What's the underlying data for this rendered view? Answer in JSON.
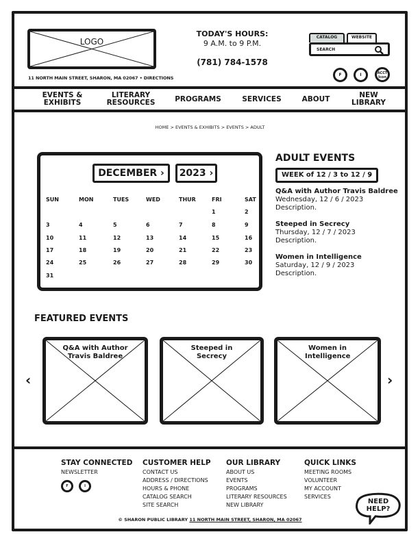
{
  "header": {
    "logo_label": "LOGO",
    "address": "11 NORTH MAIN STREET, SHARON, MA 02067 • DIRECTIONS",
    "hours_title": "TODAY'S HOURS:",
    "hours_value": "9 A.M. to 9 P.M.",
    "phone": "(781) 784-1578",
    "search_tabs": [
      "CATALOG",
      "WEBSITE"
    ],
    "search_placeholder": "SEARCH",
    "social": {
      "facebook": "F",
      "instagram": "I",
      "account": "ACCT Icon"
    }
  },
  "nav": {
    "items": [
      "EVENTS & EXHIBITS",
      "LITERARY RESOURCES",
      "PROGRAMS",
      "SERVICES",
      "ABOUT",
      "NEW LIBRARY"
    ]
  },
  "breadcrumb": "HOME > EVENTS & EXHIBITS > EVENTS > ADULT",
  "calendar": {
    "month": "DECEMBER",
    "year": "2023",
    "days_of_week": [
      "SUN",
      "MON",
      "TUES",
      "WED",
      "THUR",
      "FRI",
      "SAT"
    ],
    "first_weekday": 5,
    "days_in_month": 31
  },
  "adult_events": {
    "title": "ADULT EVENTS",
    "week_label": "WEEK of 12 / 3 to 12 / 9",
    "events": [
      {
        "title": "Q&A with Author Travis Baldree",
        "date": "Wednesday, 12 / 6 / 2023",
        "description": "Description."
      },
      {
        "title": "Steeped in Secrecy",
        "date": "Thursday, 12 / 7 / 2023",
        "description": "Description."
      },
      {
        "title": "Women in Intelligence",
        "date": "Saturday, 12 / 9 / 2023",
        "description": "Description."
      }
    ]
  },
  "featured": {
    "title": "FEATURED EVENTS",
    "cards": [
      "Q&A with Author Travis Baldree",
      "Steeped in Secrecy",
      "Women in Intelligence"
    ]
  },
  "footer": {
    "columns": [
      {
        "title": "STAY CONNECTED",
        "links": [
          "NEWSLETTER"
        ]
      },
      {
        "title": "CUSTOMER HELP",
        "links": [
          "CONTACT US",
          "ADDRESS / DIRECTIONS",
          "HOURS & PHONE",
          "CATALOG SEARCH",
          "SITE SEARCH"
        ]
      },
      {
        "title": "OUR LIBRARY",
        "links": [
          "ABOUT US",
          "EVENTS",
          "PROGRAMS",
          "LITERARY RESOURCES",
          "NEW LIBRARY"
        ]
      },
      {
        "title": "QUICK LINKS",
        "links": [
          "MEETING ROOMS",
          "VOLUNTEER",
          "MY ACCOUNT",
          "SERVICES"
        ]
      }
    ],
    "social": {
      "facebook": "F",
      "instagram": "I"
    },
    "copyright_name": "SHARON PUBLIC LIBRARY",
    "copyright_address": "11 NORTH MAIN STREET, SHARON, MA 02067",
    "help_label": "NEED HELP?"
  }
}
